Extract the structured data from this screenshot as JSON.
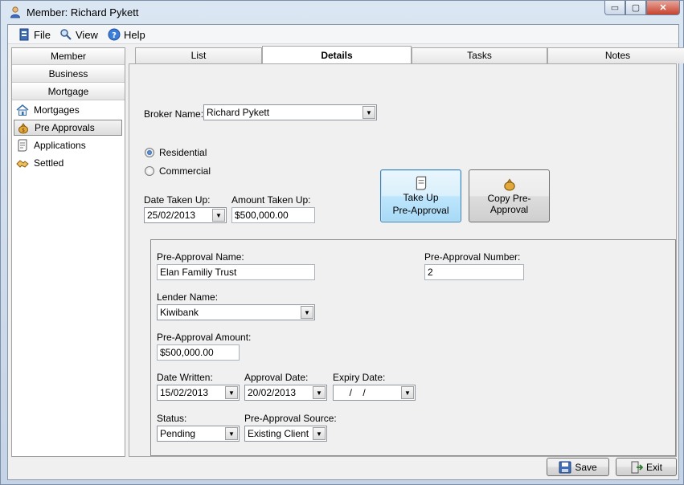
{
  "window": {
    "title": "Member: Richard Pykett",
    "minimize_glyph": "▭",
    "maximize_glyph": "▢",
    "close_glyph": "✕",
    "icon": "user-icon"
  },
  "menu": {
    "file": "File",
    "view": "View",
    "help": "Help"
  },
  "sidebar": {
    "buttons": [
      "Member",
      "Business",
      "Mortgage"
    ],
    "items": [
      {
        "label": "Mortgages",
        "icon": "house-icon"
      },
      {
        "label": "Pre Approvals",
        "icon": "moneybag-icon"
      },
      {
        "label": "Applications",
        "icon": "scroll-icon"
      },
      {
        "label": "Settled",
        "icon": "handshake-icon"
      }
    ],
    "selected": "Pre Approvals"
  },
  "tabs": [
    "List",
    "Details",
    "Tasks",
    "Notes"
  ],
  "active_tab": "Details",
  "details": {
    "broker_label": "Broker Name:",
    "broker_value": "Richard Pykett",
    "radio_residential": "Residential",
    "radio_commercial": "Commercial",
    "date_taken_label": "Date Taken Up:",
    "date_taken_value": "25/02/2013",
    "amount_taken_label": "Amount Taken Up:",
    "amount_taken_value": "$500,000.00",
    "take_up_line1": "Take Up",
    "take_up_line2": "Pre-Approval",
    "copy_label": "Copy Pre-Approval"
  },
  "preapproval": {
    "name_label": "Pre-Approval Name:",
    "name_value": "Elan Familiy Trust",
    "number_label": "Pre-Approval Number:",
    "number_value": "2",
    "lender_label": "Lender Name:",
    "lender_value": "Kiwibank",
    "amount_label": "Pre-Approval Amount:",
    "amount_value": "$500,000.00",
    "date_written_label": "Date Written:",
    "date_written_value": "15/02/2013",
    "approval_date_label": "Approval Date:",
    "approval_date_value": "20/02/2013",
    "expiry_date_label": "Expiry Date:",
    "expiry_date_value": "  /    /",
    "status_label": "Status:",
    "status_value": "Pending",
    "source_label": "Pre-Approval Source:",
    "source_value": "Existing Client"
  },
  "footer": {
    "save": "Save",
    "exit": "Exit"
  },
  "colors": {
    "accent_focus": "#3c7fb1",
    "selection_border": "#888888"
  }
}
